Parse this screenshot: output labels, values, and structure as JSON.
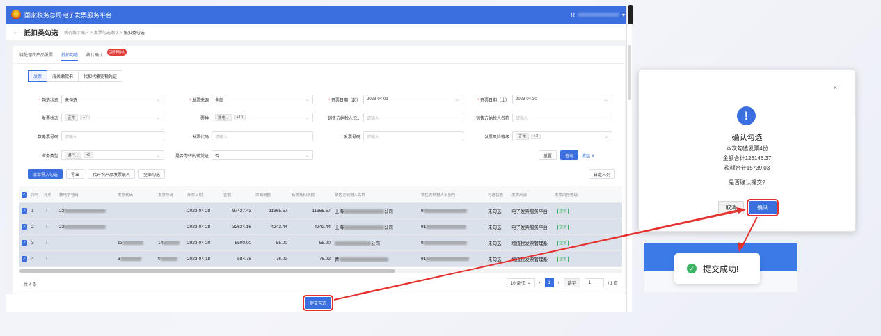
{
  "header": {
    "app_title": "国家税务总局电子发票服务平台",
    "user_prefix": "R"
  },
  "breadcrumb": {
    "back": "←",
    "page_title": "抵扣类勾选",
    "trail": "税务数字账户 > 发票勾选确认 > ",
    "current": "抵扣类勾选"
  },
  "tabs": [
    {
      "label": "待处理农产品发票"
    },
    {
      "label": "抵扣勾选"
    },
    {
      "label": "统计确认",
      "badge": "当前未确认"
    }
  ],
  "subtabs": [
    "发票",
    "海关缴款书",
    "代扣代缴完税凭证"
  ],
  "filters": {
    "gxzt": {
      "label": "勾选状态",
      "value": "未勾选"
    },
    "fply": {
      "label": "发票来源",
      "value": "全部"
    },
    "kprq_q": {
      "label": "开票日期（起）",
      "value": "2023-04-01"
    },
    "kprq_z": {
      "label": "开票日期（止）",
      "value": "2023-04-30"
    },
    "fpzt": {
      "label": "发票状态",
      "tag": "正常",
      "more": "+1"
    },
    "pz": {
      "label": "票种",
      "tag": "数电...",
      "more": "+10"
    },
    "xfsh": {
      "label": "销售方纳税人识...",
      "placeholder": "请输入"
    },
    "xfmc": {
      "label": "销售方纳税人名称",
      "placeholder": "请输入"
    },
    "sdph": {
      "label": "数电票号码",
      "placeholder": "请输入"
    },
    "fpdm": {
      "label": "发票代码",
      "placeholder": "请输入"
    },
    "fphm": {
      "label": "发票号码",
      "placeholder": "请输入"
    },
    "fxdj": {
      "label": "发票风险等级",
      "tag": "正常",
      "more": "+2"
    },
    "ywlx": {
      "label": "业务类型",
      "tag": "通行...",
      "more": "+3"
    },
    "zcnx": {
      "label": "是否为转内销凭证",
      "value": "否"
    }
  },
  "buttons": {
    "reset": "重置",
    "query": "查询",
    "collapse": "收起 ∧",
    "list_import": "清单导入勾选",
    "export": "导出",
    "agri_import": "代开农产品发票录入",
    "select_all": "全部勾选",
    "custom_cols": "自定义列"
  },
  "table": {
    "headers": [
      "序号",
      "排序",
      "数电票号码",
      "发票代码",
      "发票号码",
      "开票日期",
      "金额",
      "票面税额",
      "有效抵扣税额",
      "销售方纳税人名称",
      "销售方纳税人识别号",
      "勾选状态",
      "发票来源",
      "发票风险等级"
    ],
    "rows": [
      {
        "no": "1",
        "sdph": "23",
        "kprq": "2023-04-28",
        "je": "87427.43",
        "se": "11365.57",
        "yxse": "11365.57",
        "xfmc": "上海",
        "xfmc_tail": "公司",
        "xfsh": "9",
        "gxzt": "未勾选",
        "fply": "电子发票服务平台",
        "fxdj": "正常"
      },
      {
        "no": "2",
        "sdph": "23",
        "kprq": "2023-04-28",
        "je": "32634.16",
        "se": "4242.44",
        "yxse": "4242.44",
        "xfmc": "上海",
        "xfmc_tail": "公司",
        "xfsh": "91",
        "gxzt": "未勾选",
        "fply": "电子发票服务平台",
        "fxdj": "正常"
      },
      {
        "no": "3",
        "fpdm": "13",
        "fphm": "14",
        "kprq": "2023-04-20",
        "je": "5500.00",
        "se": "55.00",
        "yxse": "55.00",
        "xfmc": "",
        "xfmc_tail": "公司",
        "xfsh": "9",
        "gxzt": "未勾选",
        "fply": "增值税发票管理系",
        "fxdj": "正常"
      },
      {
        "no": "4",
        "fpdm": "3",
        "fphm": "0",
        "kprq": "2023-04-18",
        "je": "584.78",
        "se": "76.02",
        "yxse": "76.02",
        "xfmc": "青",
        "xfmc_tail": "",
        "xfsh": "91",
        "gxzt": "未勾选",
        "fply": "增值税发票管理系",
        "fxdj": "正常"
      }
    ]
  },
  "footer": {
    "total": "共 4 条"
  },
  "pager": {
    "page_size": "10 条/页",
    "current_page": "1",
    "jump_label": "跳至",
    "jump_value": "1",
    "total_pages": "/ 1 页"
  },
  "submit": {
    "label": "提交勾选"
  },
  "dialog": {
    "close": "×",
    "icon": "!",
    "title": "确认勾选",
    "line1": "本次勾选发票4份",
    "line2": "金额合计126146.37",
    "line3": "税额合计15739.03",
    "question": "是否确认提交?",
    "cancel": "取消",
    "ok": "确认"
  },
  "toast": {
    "message": "提交成功!"
  },
  "colors": {
    "primary": "#3b6fe0",
    "annotation_red": "#e5312d",
    "success": "#3db463",
    "danger": "#e23b3b"
  }
}
